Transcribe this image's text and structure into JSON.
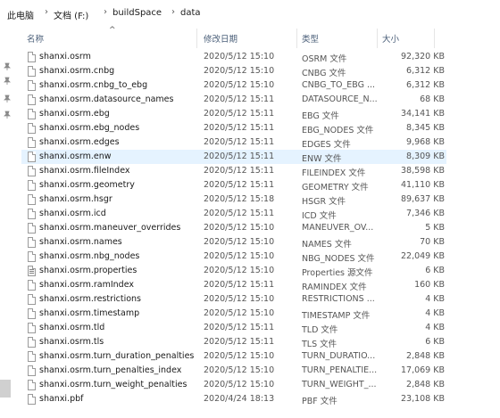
{
  "breadcrumb": {
    "items": [
      "此电脑",
      "文档 (F:)",
      "buildSpace",
      "data"
    ],
    "separator": "›"
  },
  "columns": {
    "name": "名称",
    "date": "修改日期",
    "type": "类型",
    "size": "大小"
  },
  "files": [
    {
      "name": "shanxi.osrm",
      "date": "2020/5/12 15:10",
      "type": "OSRM 文件",
      "size": "92,320 KB",
      "icon": "file-icon"
    },
    {
      "name": "shanxi.osrm.cnbg",
      "date": "2020/5/12 15:10",
      "type": "CNBG 文件",
      "size": "6,312 KB",
      "icon": "file-icon"
    },
    {
      "name": "shanxi.osrm.cnbg_to_ebg",
      "date": "2020/5/12 15:10",
      "type": "CNBG_TO_EBG ...",
      "size": "6,312 KB",
      "icon": "file-icon"
    },
    {
      "name": "shanxi.osrm.datasource_names",
      "date": "2020/5/12 15:11",
      "type": "DATASOURCE_N...",
      "size": "68 KB",
      "icon": "file-icon"
    },
    {
      "name": "shanxi.osrm.ebg",
      "date": "2020/5/12 15:11",
      "type": "EBG 文件",
      "size": "34,141 KB",
      "icon": "file-icon"
    },
    {
      "name": "shanxi.osrm.ebg_nodes",
      "date": "2020/5/12 15:11",
      "type": "EBG_NODES 文件",
      "size": "8,345 KB",
      "icon": "file-icon"
    },
    {
      "name": "shanxi.osrm.edges",
      "date": "2020/5/12 15:11",
      "type": "EDGES 文件",
      "size": "9,968 KB",
      "icon": "file-icon"
    },
    {
      "name": "shanxi.osrm.enw",
      "date": "2020/5/12 15:11",
      "type": "ENW 文件",
      "size": "8,309 KB",
      "icon": "file-icon",
      "selected": true
    },
    {
      "name": "shanxi.osrm.fileIndex",
      "date": "2020/5/12 15:11",
      "type": "FILEINDEX 文件",
      "size": "38,598 KB",
      "icon": "file-icon"
    },
    {
      "name": "shanxi.osrm.geometry",
      "date": "2020/5/12 15:11",
      "type": "GEOMETRY 文件",
      "size": "41,110 KB",
      "icon": "file-icon"
    },
    {
      "name": "shanxi.osrm.hsgr",
      "date": "2020/5/12 15:18",
      "type": "HSGR 文件",
      "size": "89,637 KB",
      "icon": "file-icon"
    },
    {
      "name": "shanxi.osrm.icd",
      "date": "2020/5/12 15:11",
      "type": "ICD 文件",
      "size": "7,346 KB",
      "icon": "file-icon"
    },
    {
      "name": "shanxi.osrm.maneuver_overrides",
      "date": "2020/5/12 15:10",
      "type": "MANEUVER_OV...",
      "size": "5 KB",
      "icon": "file-icon"
    },
    {
      "name": "shanxi.osrm.names",
      "date": "2020/5/12 15:10",
      "type": "NAMES 文件",
      "size": "70 KB",
      "icon": "file-icon"
    },
    {
      "name": "shanxi.osrm.nbg_nodes",
      "date": "2020/5/12 15:10",
      "type": "NBG_NODES 文件",
      "size": "22,049 KB",
      "icon": "file-icon"
    },
    {
      "name": "shanxi.osrm.properties",
      "date": "2020/5/12 15:10",
      "type": "Properties 源文件",
      "size": "6 KB",
      "icon": "properties-file-icon"
    },
    {
      "name": "shanxi.osrm.ramIndex",
      "date": "2020/5/12 15:11",
      "type": "RAMINDEX 文件",
      "size": "160 KB",
      "icon": "file-icon"
    },
    {
      "name": "shanxi.osrm.restrictions",
      "date": "2020/5/12 15:10",
      "type": "RESTRICTIONS ...",
      "size": "4 KB",
      "icon": "file-icon"
    },
    {
      "name": "shanxi.osrm.timestamp",
      "date": "2020/5/12 15:10",
      "type": "TIMESTAMP 文件",
      "size": "4 KB",
      "icon": "file-icon"
    },
    {
      "name": "shanxi.osrm.tld",
      "date": "2020/5/12 15:11",
      "type": "TLD 文件",
      "size": "4 KB",
      "icon": "file-icon"
    },
    {
      "name": "shanxi.osrm.tls",
      "date": "2020/5/12 15:11",
      "type": "TLS 文件",
      "size": "6 KB",
      "icon": "file-icon"
    },
    {
      "name": "shanxi.osrm.turn_duration_penalties",
      "date": "2020/5/12 15:10",
      "type": "TURN_DURATIO...",
      "size": "2,848 KB",
      "icon": "file-icon"
    },
    {
      "name": "shanxi.osrm.turn_penalties_index",
      "date": "2020/5/12 15:10",
      "type": "TURN_PENALTIE...",
      "size": "17,069 KB",
      "icon": "file-icon"
    },
    {
      "name": "shanxi.osrm.turn_weight_penalties",
      "date": "2020/5/12 15:10",
      "type": "TURN_WEIGHT_...",
      "size": "2,848 KB",
      "icon": "file-icon"
    },
    {
      "name": "shanxi.pbf",
      "date": "2020/4/24 18:13",
      "type": "PBF 文件",
      "size": "23,108 KB",
      "icon": "file-icon"
    }
  ],
  "nav": {
    "pins": [
      "pin-icon",
      "pin-icon",
      "pin-icon",
      "pin-icon"
    ]
  },
  "colors": {
    "selected_row": "#e5f3ff",
    "header_text": "#4c607a"
  }
}
